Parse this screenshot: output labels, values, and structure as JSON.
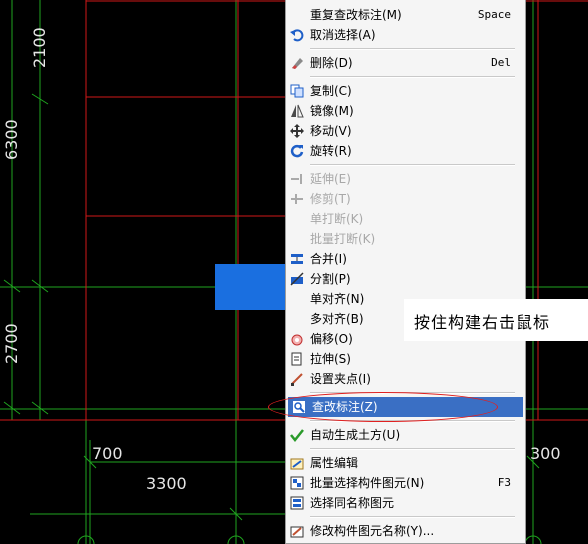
{
  "canvas": {
    "dim_labels": {
      "d2100": "2100",
      "d6300": "6300",
      "d2700": "2700",
      "d700": "700",
      "d3300": "3300",
      "d300": "300"
    }
  },
  "context_menu": {
    "items": [
      {
        "label": "重复查改标注(M)",
        "shortcut": "Space",
        "icon": "none",
        "disabled": false
      },
      {
        "label": "取消选择(A)",
        "shortcut": "",
        "icon": "undo-icon",
        "disabled": false
      },
      {
        "label": "删除(D)",
        "shortcut": "Del",
        "icon": "eraser-icon",
        "disabled": false
      },
      {
        "label": "复制(C)",
        "shortcut": "",
        "icon": "copy-icon",
        "disabled": false
      },
      {
        "label": "镜像(M)",
        "shortcut": "",
        "icon": "mirror-icon",
        "disabled": false
      },
      {
        "label": "移动(V)",
        "shortcut": "",
        "icon": "move-icon",
        "disabled": false
      },
      {
        "label": "旋转(R)",
        "shortcut": "",
        "icon": "rotate-icon",
        "disabled": false
      },
      {
        "label": "延伸(E)",
        "shortcut": "",
        "icon": "extend-icon",
        "disabled": true
      },
      {
        "label": "修剪(T)",
        "shortcut": "",
        "icon": "trim-icon",
        "disabled": true
      },
      {
        "label": "单打断(K)",
        "shortcut": "",
        "icon": "none",
        "disabled": true
      },
      {
        "label": "批量打断(K)",
        "shortcut": "",
        "icon": "none",
        "disabled": true
      },
      {
        "label": "合并(I)",
        "shortcut": "",
        "icon": "merge-icon",
        "disabled": false
      },
      {
        "label": "分割(P)",
        "shortcut": "",
        "icon": "split-icon",
        "disabled": false
      },
      {
        "label": "单对齐(N)",
        "shortcut": "",
        "icon": "none",
        "disabled": false
      },
      {
        "label": "多对齐(B)",
        "shortcut": "",
        "icon": "none",
        "disabled": false
      },
      {
        "label": "偏移(O)",
        "shortcut": "",
        "icon": "offset-icon",
        "disabled": false
      },
      {
        "label": "拉伸(S)",
        "shortcut": "",
        "icon": "stretch-icon",
        "disabled": false
      },
      {
        "label": "设置夹点(I)",
        "shortcut": "",
        "icon": "grip-icon",
        "disabled": false
      },
      {
        "label": "查改标注(Z)",
        "shortcut": "",
        "icon": "check-annotation-icon",
        "disabled": false,
        "selected": true
      },
      {
        "label": "自动生成土方(U)",
        "shortcut": "",
        "icon": "checkmark-icon",
        "disabled": false
      },
      {
        "label": "属性编辑",
        "shortcut": "",
        "icon": "property-edit-icon",
        "disabled": false
      },
      {
        "label": "批量选择构件图元(N)",
        "shortcut": "F3",
        "icon": "batch-select-icon",
        "disabled": false
      },
      {
        "label": "选择同名称图元",
        "shortcut": "",
        "icon": "select-same-icon",
        "disabled": false
      },
      {
        "label": "修改构件图元名称(Y)...",
        "shortcut": "",
        "icon": "rename-icon",
        "disabled": false
      }
    ]
  },
  "callout": {
    "text": "按住构建右击鼠标"
  },
  "colors": {
    "grid_green": "#1fa51f",
    "grid_red": "#d01818",
    "selection_blue": "#3a6fc4",
    "block_blue": "#1a6fe0",
    "menu_bg": "#f5f5f5"
  }
}
